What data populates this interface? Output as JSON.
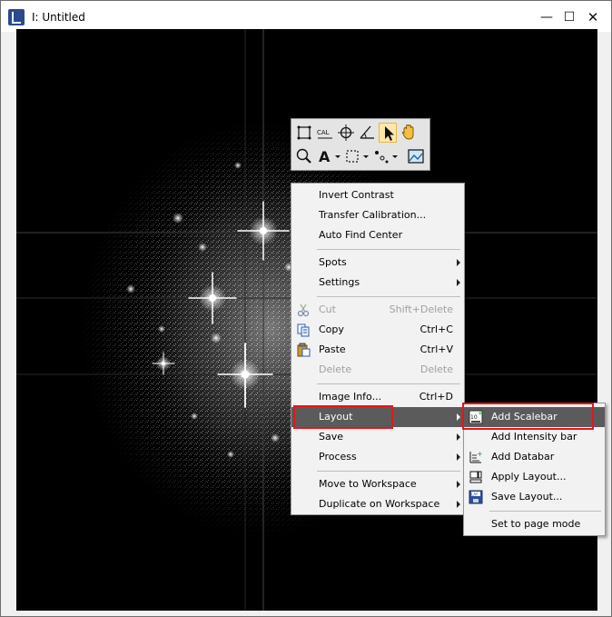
{
  "window": {
    "title": "I: Untitled",
    "controls": {
      "minimize": "—",
      "maximize": "☐",
      "close": "✕"
    }
  },
  "toolbar": {
    "tools": [
      {
        "name": "roi-tool",
        "active": false
      },
      {
        "name": "calibration-tool",
        "label": "CAL",
        "active": false
      },
      {
        "name": "crosshair-tool",
        "active": false
      },
      {
        "name": "angle-tool",
        "active": false
      },
      {
        "name": "pointer-tool",
        "active": true
      },
      {
        "name": "hand-tool",
        "active": false
      },
      {
        "name": "zoom-tool",
        "active": false
      },
      {
        "name": "text-tool",
        "label": "A",
        "active": false
      },
      {
        "name": "selection-tool",
        "active": false
      },
      {
        "name": "spot-tool",
        "active": false
      },
      {
        "name": "image-tool",
        "active": false
      }
    ]
  },
  "context_menu": {
    "items": [
      {
        "label": "Invert Contrast"
      },
      {
        "label": "Transfer Calibration..."
      },
      {
        "label": "Auto Find Center"
      },
      {
        "label": "Spots",
        "submenu": true
      },
      {
        "label": "Settings",
        "submenu": true
      },
      {
        "label": "Cut",
        "shortcut": "Shift+Delete",
        "disabled": true,
        "icon": "scissors-icon"
      },
      {
        "label": "Copy",
        "shortcut": "Ctrl+C",
        "icon": "copy-icon"
      },
      {
        "label": "Paste",
        "shortcut": "Ctrl+V",
        "icon": "paste-icon"
      },
      {
        "label": "Delete",
        "shortcut": "Delete",
        "disabled": true
      },
      {
        "label": "Image Info...",
        "shortcut": "Ctrl+D"
      },
      {
        "label": "Layout",
        "submenu": true,
        "highlighted": true
      },
      {
        "label": "Save",
        "submenu": true
      },
      {
        "label": "Process",
        "submenu": true
      },
      {
        "label": "Move to Workspace",
        "submenu": true
      },
      {
        "label": "Duplicate on Workspace",
        "submenu": true
      }
    ]
  },
  "layout_submenu": {
    "items": [
      {
        "label": "Add Scalebar",
        "highlighted": true,
        "icon": "scalebar-icon"
      },
      {
        "label": "Add Intensity bar"
      },
      {
        "label": "Add Databar",
        "icon": "databar-icon"
      },
      {
        "label": "Apply Layout...",
        "icon": "apply-layout-icon"
      },
      {
        "label": "Save Layout...",
        "icon": "save-layout-icon"
      },
      {
        "label": "Set to page mode"
      }
    ]
  },
  "colors": {
    "highlight": "#5b5b5b",
    "annotation": "#e8141b",
    "image_background": "#000000"
  }
}
